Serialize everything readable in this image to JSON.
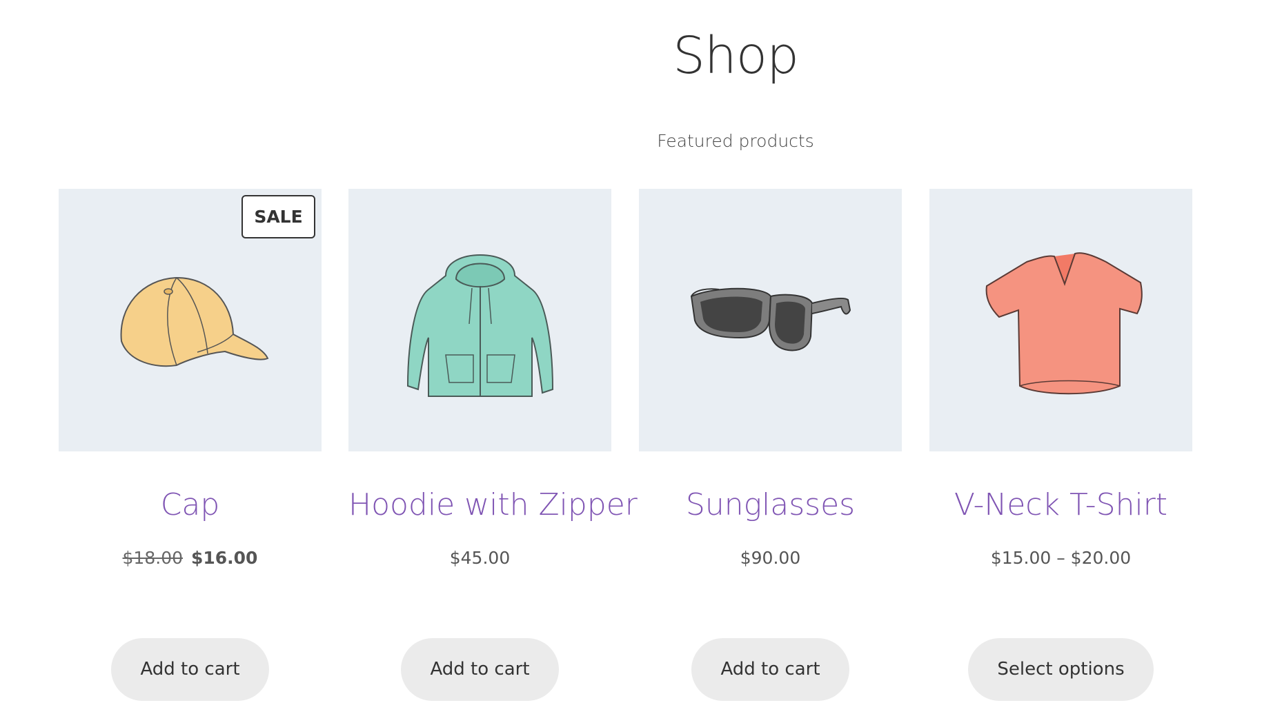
{
  "page": {
    "title": "Shop",
    "subtitle": "Featured products"
  },
  "products": [
    {
      "name": "Cap",
      "sale_badge": "SALE",
      "price_old": "$18.00",
      "price_new": "$16.00",
      "button_label": "Add to cart",
      "icon": "cap-illustration"
    },
    {
      "name": "Hoodie with Zipper",
      "price": "$45.00",
      "button_label": "Add to cart",
      "icon": "hoodie-illustration"
    },
    {
      "name": "Sunglasses",
      "price": "$90.00",
      "button_label": "Add to cart",
      "icon": "sunglasses-illustration"
    },
    {
      "name": "V-Neck T-Shirt",
      "price": "$15.00 – $20.00",
      "button_label": "Select options",
      "icon": "tshirt-illustration"
    }
  ],
  "colors": {
    "product_title": "#7f54b3",
    "image_background": "#e9eef3",
    "button_background": "#ebebeb"
  }
}
